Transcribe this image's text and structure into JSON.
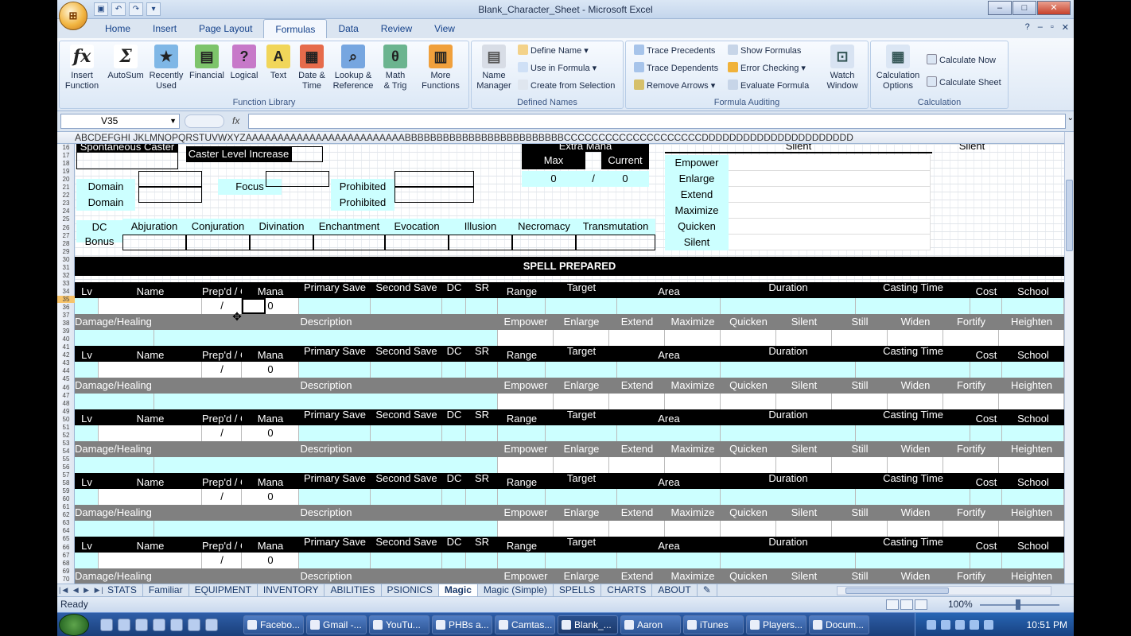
{
  "window": {
    "title": "Blank_Character_Sheet - Microsoft Excel"
  },
  "ribbon": {
    "tabs": [
      "Home",
      "Insert",
      "Page Layout",
      "Formulas",
      "Data",
      "Review",
      "View"
    ],
    "active_tab": "Formulas",
    "groups": {
      "function_library": {
        "label": "Function Library",
        "buttons": [
          {
            "icon": "fx-icon",
            "label": "Insert\nFunction"
          },
          {
            "icon": "sigma-icon",
            "label": "AutoSum"
          },
          {
            "icon": "star-book-icon",
            "label": "Recently\nUsed"
          },
          {
            "icon": "book-icon",
            "label": "Financial"
          },
          {
            "icon": "question-book-icon",
            "label": "Logical"
          },
          {
            "icon": "a-book-icon",
            "label": "Text"
          },
          {
            "icon": "calendar-book-icon",
            "label": "Date &\nTime"
          },
          {
            "icon": "magnifier-book-icon",
            "label": "Lookup &\nReference"
          },
          {
            "icon": "theta-book-icon",
            "label": "Math\n& Trig"
          },
          {
            "icon": "books-icon",
            "label": "More\nFunctions"
          }
        ]
      },
      "defined_names": {
        "label": "Defined Names",
        "big": "Name\nManager",
        "small": [
          "Define Name",
          "Use in Formula",
          "Create from Selection"
        ]
      },
      "formula_auditing": {
        "label": "Formula Auditing",
        "small": [
          "Trace Precedents",
          "Trace Dependents",
          "Remove Arrows",
          "Show Formulas",
          "Error Checking",
          "Evaluate Formula"
        ],
        "big": "Watch\nWindow"
      },
      "calculation": {
        "label": "Calculation",
        "big": "Calculation\nOptions",
        "small": [
          "Calculate Now",
          "Calculate Sheet"
        ]
      }
    }
  },
  "formula_bar": {
    "name_box": "V35",
    "fx": "fx",
    "formula": ""
  },
  "column_header": "ABCDEFGHI JKLMNOPQRSTUVWXYZAAAAAAAAAAAAAAAAAAAAAAAAABBBBBBBBBBBBBBBBBBBBBBBBBCCCCCCCCCCCCCCCCCCCCDDDDDDDDDDDDDDDDDDDDDD",
  "row_numbers": [
    "16",
    "17",
    "18",
    "19",
    "20",
    "21",
    "22",
    "23",
    "24",
    "25",
    "26",
    "27",
    "28",
    "29",
    "30",
    "31",
    "32",
    "33",
    "34",
    "35",
    "36",
    "37",
    "38",
    "39",
    "40",
    "41",
    "42",
    "43",
    "44",
    "45",
    "46",
    "47",
    "48",
    "49",
    "50",
    "51",
    "52",
    "53",
    "54",
    "55",
    "56",
    "57",
    "58",
    "59",
    "60",
    "61",
    "62",
    "63",
    "64",
    "65",
    "66",
    "67",
    "68",
    "69",
    "70"
  ],
  "sheet": {
    "top": {
      "spontaneous_caster": "Spontaneous Caster",
      "caster_level_increase": "Caster Level Increase",
      "extra_mana": "Extra Mana",
      "max_label": "Max",
      "current_label": "Current",
      "max_value": "0",
      "slash": "/",
      "current_value": "0",
      "silent_top": "Silent",
      "silent_right": "Silent",
      "metamagic": [
        "Empower",
        "Enlarge",
        "Extend",
        "Maximize",
        "Quicken",
        "Silent"
      ],
      "domain_label": "Domain",
      "focus_label": "Focus",
      "prohibited_label": "Prohibited",
      "dc_label": "DC",
      "bonus_label": "Bonus",
      "schools": [
        "Abjuration",
        "Conjuration",
        "Divination",
        "Enchantment",
        "Evocation",
        "Illusion",
        "Necromacy",
        "Transmutation"
      ],
      "spell_prepared": "SPELL PREPARED"
    },
    "spell_header": [
      "Lv",
      "Name",
      "Prep'd / Cast",
      "Mana",
      "Primary Save",
      "Second Save",
      "DC",
      "SR",
      "Range",
      "Target",
      "Area",
      "Duration",
      "Casting Time",
      "Cost",
      "School"
    ],
    "spell_row": {
      "slash": "/",
      "mana": "0"
    },
    "damage_header": [
      "Damage/Healing",
      "Description",
      "Empower",
      "Enlarge",
      "Extend",
      "Maximize",
      "Quicken",
      "Silent",
      "Still",
      "Widen",
      "Fortify",
      "Heighten"
    ]
  },
  "sheet_tabs": [
    "STATS",
    "Familiar",
    "EQUIPMENT",
    "INVENTORY",
    "ABILITIES",
    "PSIONICS",
    "Magic",
    "Magic (Simple)",
    "SPELLS",
    "CHARTS",
    "ABOUT"
  ],
  "active_sheet": "Magic",
  "status": {
    "ready": "Ready",
    "zoom": "100%"
  },
  "taskbar": {
    "buttons": [
      "Facebo...",
      "Gmail -...",
      "YouTu...",
      "PHBs a...",
      "Camtas...",
      "Blank_...",
      "Aaron",
      "iTunes",
      "Players...",
      "Docum..."
    ],
    "active": "Blank_...",
    "clock": "10:51 PM"
  },
  "colors": {
    "cyan_cell": "#ccffff",
    "black_header": "#000000",
    "gray_header": "#808080"
  }
}
